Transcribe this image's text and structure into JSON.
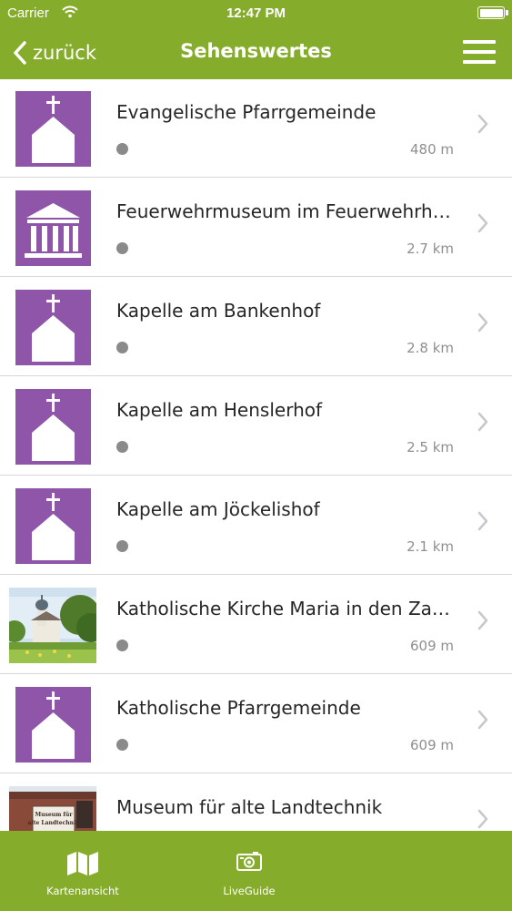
{
  "status_bar": {
    "carrier": "Carrier",
    "time": "12:47 PM"
  },
  "nav": {
    "back_label": "zurück",
    "title": "Sehenswertes"
  },
  "items": [
    {
      "title": "Evangelische Pfarrgemeinde",
      "distance": "480 m",
      "icon": "church-icon"
    },
    {
      "title": "Feuerwehrmuseum im Feuerwehrhaus",
      "distance": "2.7 km",
      "icon": "museum-icon"
    },
    {
      "title": "Kapelle am Bankenhof",
      "distance": "2.8 km",
      "icon": "church-icon"
    },
    {
      "title": "Kapelle am Henslerhof",
      "distance": "2.5 km",
      "icon": "church-icon"
    },
    {
      "title": "Kapelle am Jöckelishof",
      "distance": "2.1 km",
      "icon": "church-icon"
    },
    {
      "title": "Katholische Kirche Maria in den Zarten",
      "distance": "609 m",
      "icon": "church-photo"
    },
    {
      "title": "Katholische Pfarrgemeinde",
      "distance": "609 m",
      "icon": "church-icon"
    },
    {
      "title": "Museum für alte Landtechnik",
      "distance": "",
      "icon": "museum-photo",
      "photo_sign": "Museum für alte Landtechnik"
    }
  ],
  "tabbar": {
    "map_label": "Kartenansicht",
    "live_label": "LiveGuide"
  },
  "colors": {
    "accent": "#86ac2c",
    "poi_purple": "#8e55a9",
    "separator": "#d6d6d6"
  }
}
